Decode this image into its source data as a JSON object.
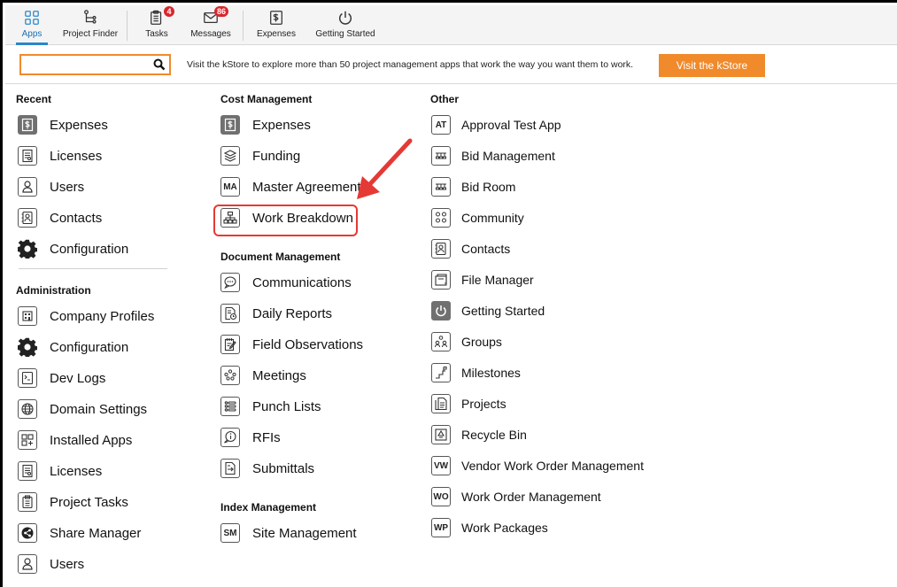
{
  "toolbar": {
    "items": [
      {
        "label": "Apps",
        "icon": "apps-grid-icon"
      },
      {
        "label": "Project Finder",
        "icon": "project-tree-icon"
      },
      {
        "label": "Tasks",
        "icon": "clipboard-icon",
        "badge": "4"
      },
      {
        "label": "Messages",
        "icon": "envelope-icon",
        "badge": "86"
      },
      {
        "label": "Expenses",
        "icon": "dollar-doc-icon"
      },
      {
        "label": "Getting Started",
        "icon": "power-icon"
      }
    ]
  },
  "search": {
    "value": "",
    "placeholder": ""
  },
  "kstore": {
    "message": "Visit the kStore to explore more than 50 project management apps that work the way you want them to work.",
    "button_label": "Visit the kStore"
  },
  "recent": {
    "title": "Recent",
    "items": [
      "Expenses",
      "Licenses",
      "Users",
      "Contacts",
      "Configuration"
    ]
  },
  "administration": {
    "title": "Administration",
    "items": [
      "Company Profiles",
      "Configuration",
      "Dev Logs",
      "Domain Settings",
      "Installed Apps",
      "Licenses",
      "Project Tasks",
      "Share Manager",
      "Users"
    ]
  },
  "cost_management": {
    "title": "Cost Management",
    "items": [
      "Expenses",
      "Funding",
      "Master Agreement",
      "Work Breakdown"
    ],
    "master_agreement_abbr": "MA"
  },
  "document_management": {
    "title": "Document Management",
    "items": [
      "Communications",
      "Daily Reports",
      "Field Observations",
      "Meetings",
      "Punch Lists",
      "RFIs",
      "Submittals"
    ]
  },
  "index_management": {
    "title": "Index Management",
    "items": [
      "Site Management"
    ],
    "site_management_abbr": "SM"
  },
  "other": {
    "title": "Other",
    "items": [
      "Approval Test App",
      "Bid Management",
      "Bid Room",
      "Community",
      "Contacts",
      "File Manager",
      "Getting Started",
      "Groups",
      "Milestones",
      "Projects",
      "Recycle Bin",
      "Vendor Work Order Management",
      "Work Order Management",
      "Work Packages"
    ],
    "abbr": {
      "approval": "AT",
      "vendor": "VW",
      "work_order": "WO",
      "work_packages": "WP"
    }
  },
  "colors": {
    "accent_orange": "#f08a2a",
    "highlight_red": "#e53935",
    "active_blue": "#1a6fb5"
  }
}
